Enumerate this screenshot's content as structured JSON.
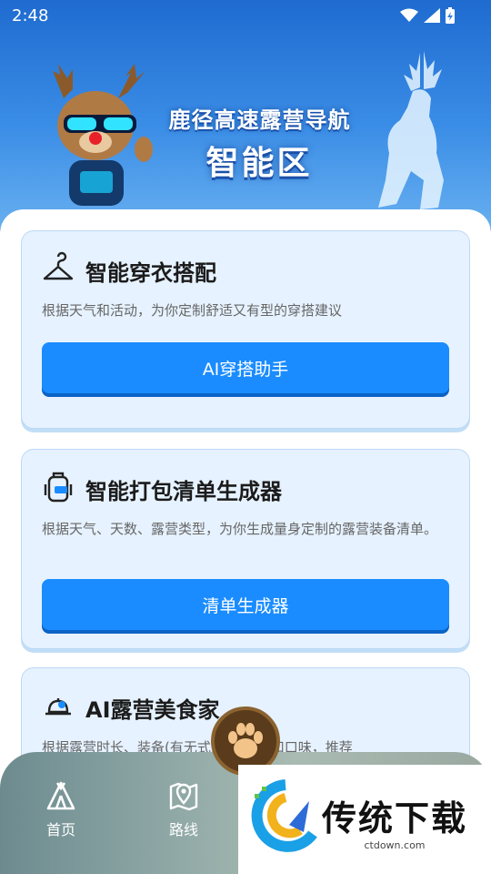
{
  "status": {
    "time": "2:48"
  },
  "banner": {
    "title": "鹿径高速露营导航",
    "subtitle": "智能区"
  },
  "cards": [
    {
      "title": "智能穿衣搭配",
      "icon": "hanger-icon",
      "desc": "根据天气和活动，为你定制舒适又有型的穿搭建议",
      "button": "AI穿搭助手"
    },
    {
      "title": "智能打包清单生成器",
      "icon": "backpack-icon",
      "desc": "根据天气、天数、露营类型，为你生成量身定制的露营装备清单。",
      "button": "清单生成器"
    },
    {
      "title": "AI露营美食家",
      "icon": "cooking-pot-icon",
      "desc": "根据露营时长、装备(有无式炉)、人数和口味，推荐"
    }
  ],
  "nav": {
    "items": [
      {
        "label": "首页",
        "icon": "tent-icon"
      },
      {
        "label": "路线",
        "icon": "map-pin-icon"
      }
    ],
    "center_icon": "paw-icon"
  },
  "watermark": {
    "text": "传统下载",
    "url": "ctdown.com"
  },
  "colors": {
    "accent": "#1a8cff",
    "card_bg": "#e6f2ff",
    "banner": "#2f7fd8"
  }
}
